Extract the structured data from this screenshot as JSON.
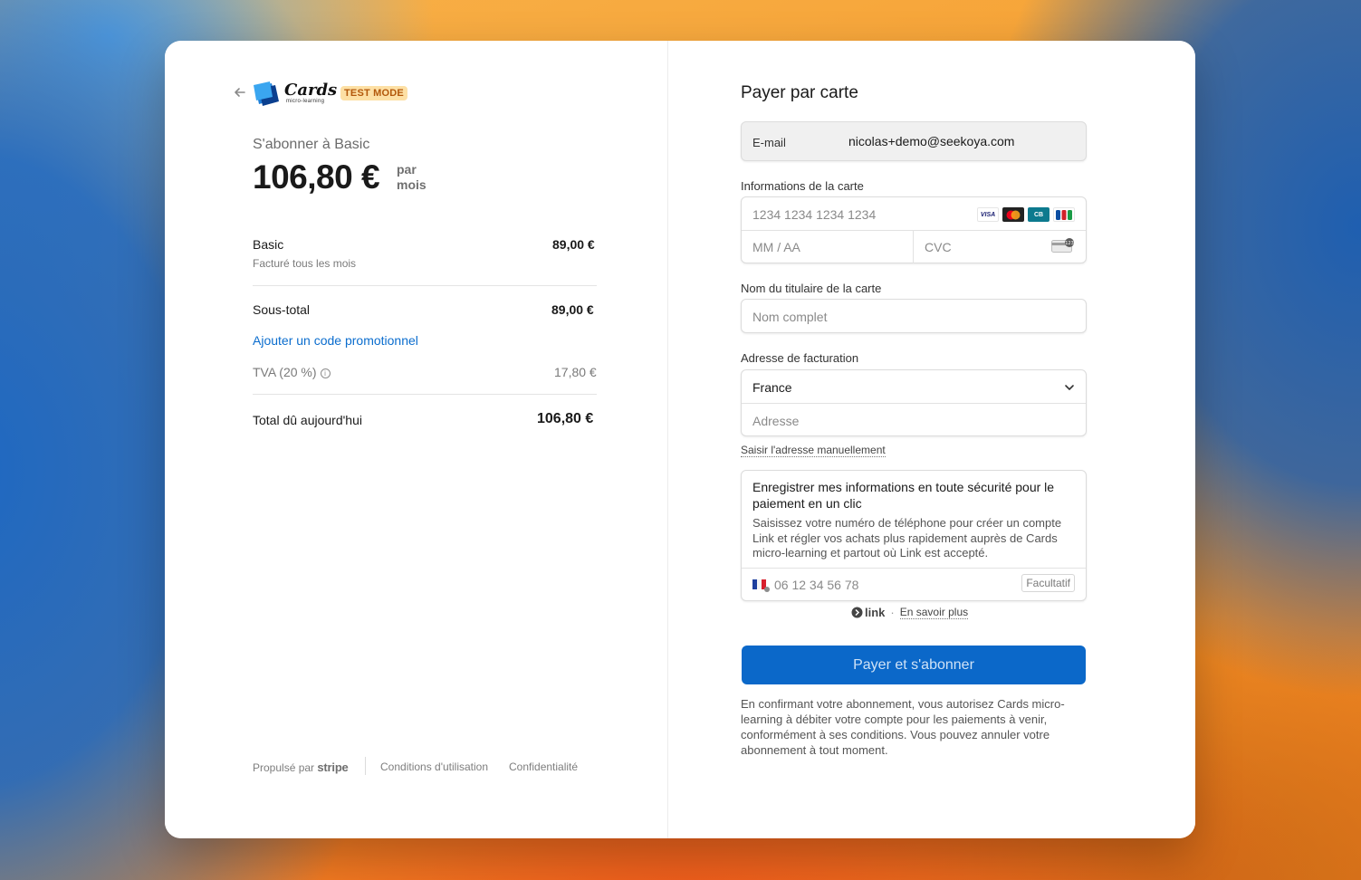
{
  "header": {
    "back_icon": "arrow-left-icon",
    "logo_text": "Cards",
    "logo_sub": "micro-learning",
    "badge": "TEST MODE"
  },
  "summary": {
    "subscribe_title": "S'abonner à Basic",
    "price": "106,80 €",
    "per_line1": "par",
    "per_line2": "mois",
    "items": [
      {
        "name": "Basic",
        "desc": "Facturé tous les mois",
        "amount": "89,00 €"
      }
    ],
    "subtotal_label": "Sous-total",
    "subtotal_amount": "89,00 €",
    "promo_link": "Ajouter un code promotionnel",
    "tax_label": "TVA (20 %)",
    "tax_amount": "17,80 €",
    "total_label": "Total dû aujourd'hui",
    "total_amount": "106,80 €"
  },
  "footer": {
    "powered_by": "Propulsé par",
    "stripe": "stripe",
    "terms": "Conditions d'utilisation",
    "privacy": "Confidentialité"
  },
  "payment": {
    "title": "Payer par carte",
    "email_label": "E-mail",
    "email_value": "nicolas+demo@seekoya.com",
    "card_label": "Informations de la carte",
    "card_number_placeholder": "1234 1234 1234 1234",
    "card_brands": [
      "VISA",
      "mastercard",
      "CB",
      "JCB"
    ],
    "expiry_placeholder": "MM / AA",
    "cvc_placeholder": "CVC",
    "name_label": "Nom du titulaire de la carte",
    "name_placeholder": "Nom complet",
    "billing_label": "Adresse de facturation",
    "country": "France",
    "address_placeholder": "Adresse",
    "manual_address_link": "Saisir l'adresse manuellement",
    "link_title": "Enregistrer mes informations en toute sécurité pour le paiement en un clic",
    "link_desc": "Saisissez votre numéro de téléphone pour créer un compte Link et régler vos achats plus rapidement auprès de Cards micro-learning et partout où Link est accepté.",
    "phone_placeholder": "06 12 34 56 78",
    "optional_badge": "Facultatif",
    "link_brand": "link",
    "learn_more": "En savoir plus",
    "pay_button": "Payer et s'abonner",
    "consent": "En confirmant votre abonnement, vous autorisez Cards micro-learning à débiter votre compte pour les paiements à venir, conformément à ses conditions. Vous pouvez annuler votre abonnement à tout moment."
  },
  "colors": {
    "accent": "#0b68c9",
    "link": "#0b6dce",
    "badge_bg": "#fde0a5",
    "badge_text": "#b3580b"
  }
}
